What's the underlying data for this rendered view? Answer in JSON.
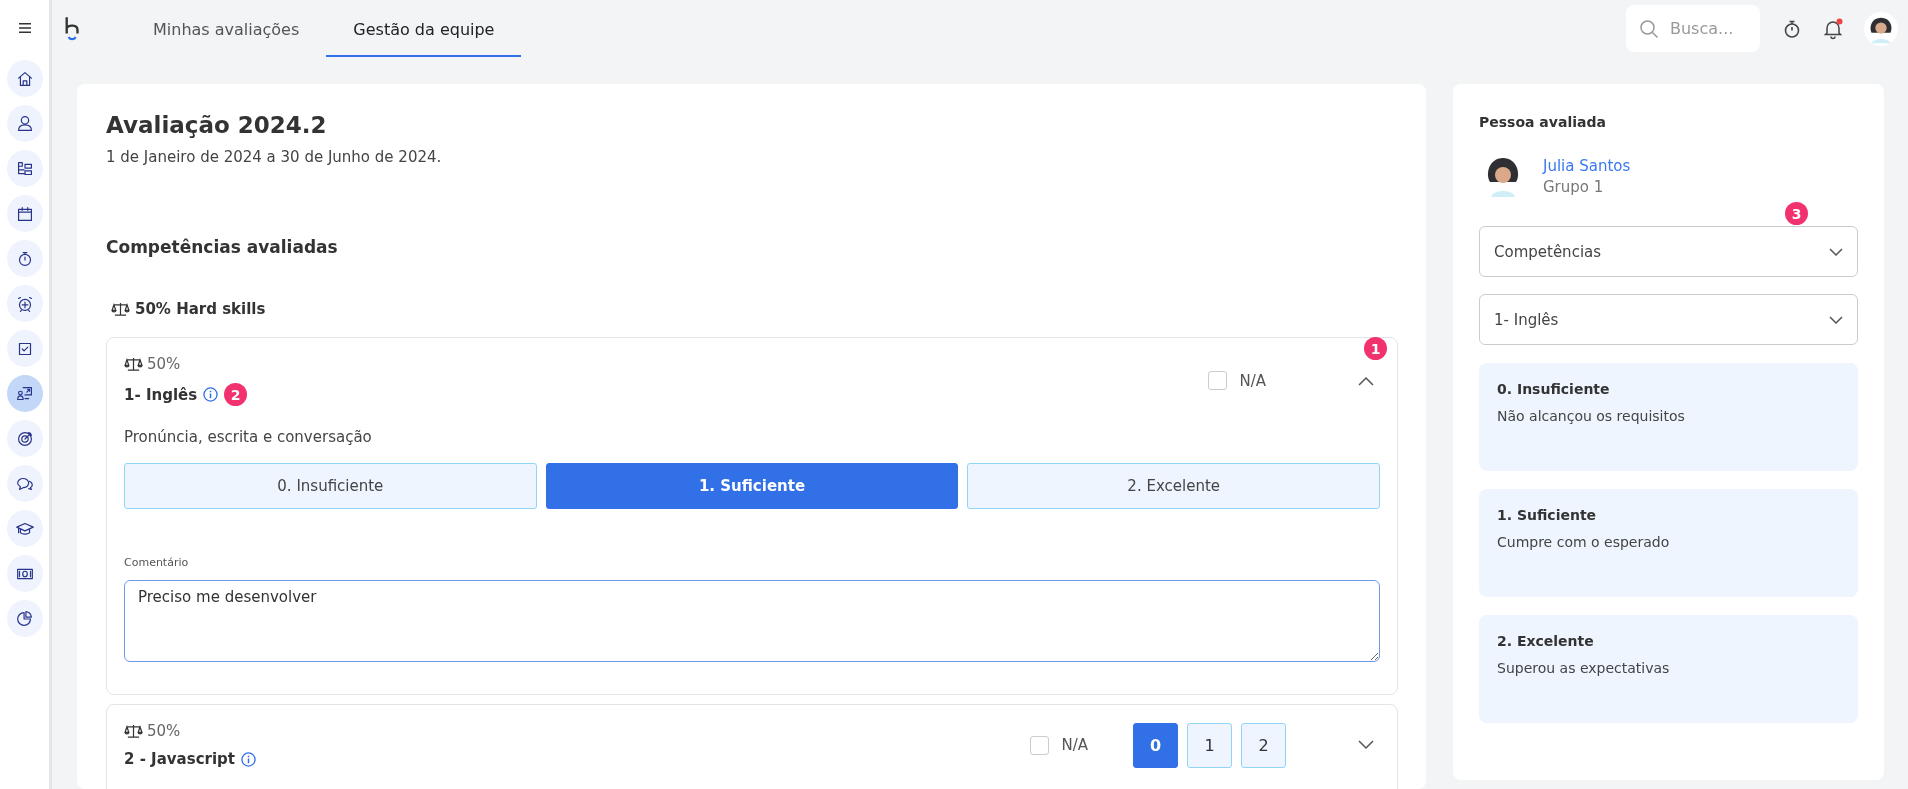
{
  "sidebar": {
    "items": [
      {
        "kind": "home",
        "selected": false
      },
      {
        "kind": "person",
        "selected": false
      },
      {
        "kind": "org",
        "selected": false
      },
      {
        "kind": "calendar",
        "selected": false
      },
      {
        "kind": "stopwatch",
        "selected": false
      },
      {
        "kind": "alarm",
        "selected": false
      },
      {
        "kind": "checkbox",
        "selected": false
      },
      {
        "kind": "presentation",
        "selected": true
      },
      {
        "kind": "target",
        "selected": false
      },
      {
        "kind": "chat",
        "selected": false
      },
      {
        "kind": "graduation",
        "selected": false
      },
      {
        "kind": "money",
        "selected": false
      },
      {
        "kind": "pie",
        "selected": false
      }
    ]
  },
  "topbar": {
    "tabs": [
      {
        "label": "Minhas avaliações",
        "selected": false
      },
      {
        "label": "Gestão da equipe",
        "selected": true
      }
    ],
    "search": {
      "placeholder": "Busca..."
    },
    "notification_unread": true
  },
  "evaluation": {
    "title": "Avaliação 2024.2",
    "period": "1 de Janeiro de 2024 a 30 de Junho de 2024.",
    "section_title": "Competências avaliadas",
    "group_label": "50% Hard skills",
    "competencies": [
      {
        "weight": "50%",
        "name": "1- Inglês",
        "name_marker": "2",
        "card_marker": "1",
        "na_label": "N/A",
        "na_checked": false,
        "expanded": true,
        "description": "Pronúncia, escrita e conversação",
        "levels": [
          {
            "label": "0. Insuficiente",
            "selected": false
          },
          {
            "label": "1. Suficiente",
            "selected": true
          },
          {
            "label": "2. Excelente",
            "selected": false
          }
        ],
        "comment": {
          "label": "Comentário",
          "value": "Preciso me desenvolver"
        }
      },
      {
        "weight": "50%",
        "name": "2 - Javascript",
        "na_label": "N/A",
        "na_checked": false,
        "expanded": false,
        "levels": [
          {
            "label": "0",
            "selected": true
          },
          {
            "label": "1",
            "selected": false
          },
          {
            "label": "2",
            "selected": false
          }
        ]
      }
    ]
  },
  "person_panel": {
    "title": "Pessoa avaliada",
    "name": "Julia Santos",
    "group": "Grupo 1",
    "marker": "3",
    "selects": [
      {
        "value": "Competências"
      },
      {
        "value": "1- Inglês"
      }
    ],
    "level_descriptions": [
      {
        "title": "0. Insuficiente",
        "description": "Não alcançou os requisitos"
      },
      {
        "title": "1. Suficiente",
        "description": "Cumpre com o esperado"
      },
      {
        "title": "2. Excelente",
        "description": "Superou as expectativas"
      }
    ]
  }
}
